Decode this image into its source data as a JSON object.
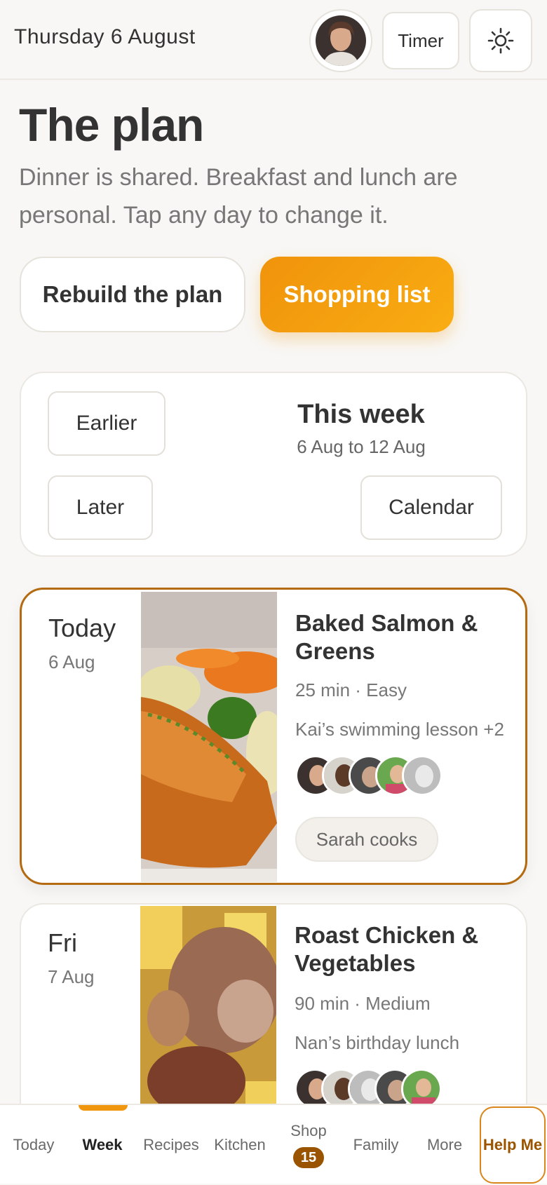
{
  "header": {
    "date": "Thursday 6 August",
    "avatar_icon": "user-avatar",
    "timer_label": "Timer",
    "theme_icon": "sun-icon"
  },
  "page": {
    "title": "The plan",
    "subtitle": "Dinner is shared. Breakfast and lunch are personal. Tap any day to change it."
  },
  "actions": {
    "rebuild_label": "Rebuild the plan",
    "shopping_label": "Shopping list"
  },
  "week_nav": {
    "earlier_label": "Earlier",
    "later_label": "Later",
    "calendar_label": "Calendar",
    "title": "This week",
    "range": "6 Aug to 12 Aug"
  },
  "days": [
    {
      "day": "Today",
      "date": "6 Aug",
      "meal": "Baked Salmon & Greens",
      "meta": "25 min · Easy",
      "note": "Kai’s swimming lesson +2",
      "cook": "Sarah cooks",
      "image_icon": "salmon-photo"
    },
    {
      "day": "Fri",
      "date": "7 Aug",
      "meal": "Roast Chicken & Vegetables",
      "meta": "90 min · Medium",
      "note": "Nan’s birthday lunch",
      "image_icon": "roast-chicken-photo"
    }
  ],
  "nav": {
    "today": "Today",
    "week": "Week",
    "recipes": "Recipes",
    "kitchen": "Kitchen",
    "shop": "Shop",
    "shop_badge": "15",
    "family": "Family",
    "more": "More",
    "help": "Help Me"
  },
  "colors": {
    "accent": "#f0960e",
    "accent_dark": "#9a5400",
    "today_border": "#b36a10",
    "background": "#f8f7f5"
  }
}
